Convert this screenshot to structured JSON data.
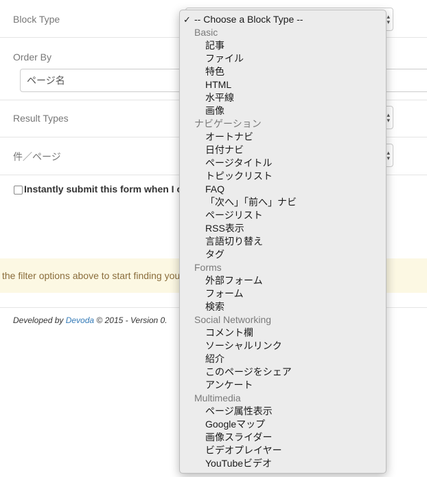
{
  "form": {
    "block_type": {
      "label": "Block Type"
    },
    "order_by": {
      "label": "Order By",
      "value": "ページ名"
    },
    "result_types": {
      "label": "Result Types"
    },
    "per_page": {
      "label": "件／ページ"
    },
    "instant_submit": {
      "label": "Instantly submit this form when I c",
      "checked": false
    }
  },
  "alert": {
    "text": "the filter options above to start finding you"
  },
  "footer": {
    "prefix": "Developed by ",
    "link": "Devoda",
    "suffix": " © 2015 - Version 0."
  },
  "dropdown": {
    "checkmark": "✓",
    "selected_label": "-- Choose a Block Type --",
    "groups": [
      {
        "label": "Basic",
        "items": [
          "記事",
          "ファイル",
          "特色",
          "HTML",
          "水平線",
          "画像"
        ]
      },
      {
        "label": "ナビゲーション",
        "items": [
          "オートナビ",
          "日付ナビ",
          "ページタイトル",
          "トピックリスト",
          "FAQ",
          "「次へ」「前へ」ナビ",
          "ページリスト",
          "RSS表示",
          "言語切り替え",
          "タグ"
        ]
      },
      {
        "label": "Forms",
        "items": [
          "外部フォーム",
          "フォーム",
          "検索"
        ]
      },
      {
        "label": "Social Networking",
        "items": [
          "コメント欄",
          "ソーシャルリンク",
          "紹介",
          "このページをシェア",
          "アンケート"
        ]
      },
      {
        "label": "Multimedia",
        "items": [
          "ページ属性表示",
          "Googleマップ",
          "画像スライダー",
          "ビデオプレイヤー",
          "YouTubeビデオ"
        ]
      }
    ]
  }
}
